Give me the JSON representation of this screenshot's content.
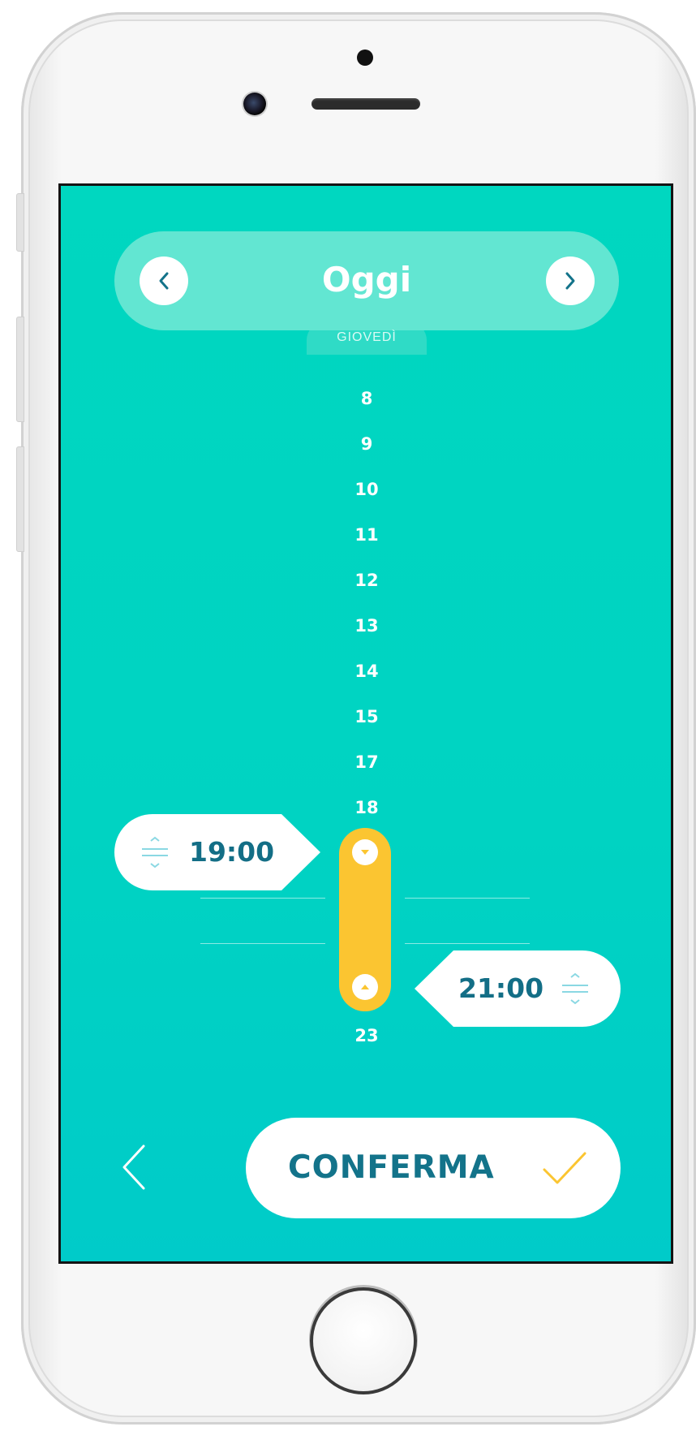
{
  "header": {
    "day_title": "Oggi",
    "weekday": "GIOVEDÌ"
  },
  "timeline": {
    "hours": [
      "8",
      "9",
      "10",
      "11",
      "12",
      "13",
      "14",
      "15",
      "17",
      "18",
      "23"
    ]
  },
  "range": {
    "start_time": "19:00",
    "end_time": "21:00"
  },
  "footer": {
    "confirm_label": "CONFERMA"
  },
  "colors": {
    "screen_bg": "#00d5c4",
    "pill_bg": "#62e6d2",
    "range_bar": "#fbc531",
    "text_dark_teal": "#136e86",
    "checkmark": "#fbc531"
  }
}
